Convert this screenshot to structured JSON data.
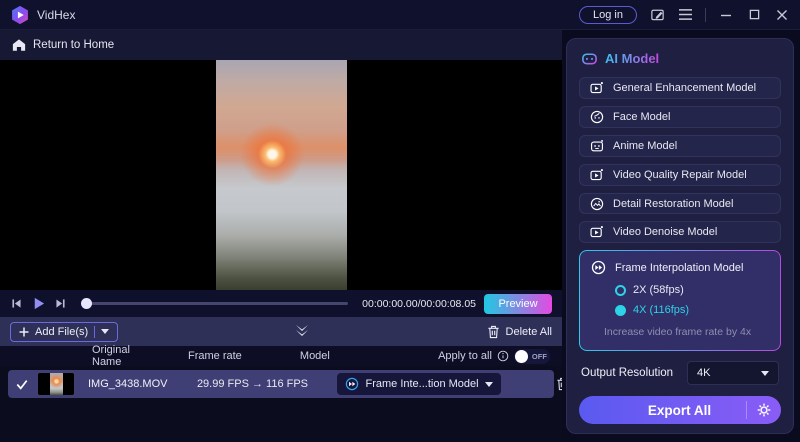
{
  "titlebar": {
    "app_name": "VidHex",
    "login_label": "Log in"
  },
  "nav": {
    "return_home": "Return to Home"
  },
  "player": {
    "time": "00:00:00.00/00:00:08.05",
    "preview_label": "Preview"
  },
  "toolbar": {
    "add_files_label": "Add File(s)",
    "delete_all_label": "Delete All"
  },
  "filetable": {
    "headers": [
      "Original Name",
      "Frame rate",
      "Model"
    ],
    "apply_to_all_label": "Apply to all",
    "toggle_state": "OFF",
    "rows": [
      {
        "name": "IMG_3438.MOV",
        "fps": "29.99 FPS → 116 FPS",
        "model": "Frame Inte...tion Model"
      }
    ]
  },
  "sidebar": {
    "title": "AI Model",
    "models": [
      "General Enhancement Model",
      "Face Model",
      "Anime Model",
      "Video Quality Repair Model",
      "Detail Restoration Model",
      "Video Denoise Model"
    ],
    "selected_model": {
      "label": "Frame Interpolation Model",
      "options": [
        {
          "label": "2X (58fps)",
          "selected": false
        },
        {
          "label": "4X (116fps)",
          "selected": true
        }
      ],
      "description": "Increase video frame rate by 4x"
    },
    "output_resolution_label": "Output Resolution",
    "output_resolution_value": "4K",
    "export_label": "Export All"
  },
  "colors": {
    "accent_cyan": "#2dd3e6",
    "accent_purple": "#8a5cf6",
    "preview_gradient": [
      "#1fc9e2",
      "#e44ae0"
    ],
    "export_gradient": [
      "#5a5af0",
      "#8a5cf6"
    ],
    "selected_row": "#403f75"
  }
}
